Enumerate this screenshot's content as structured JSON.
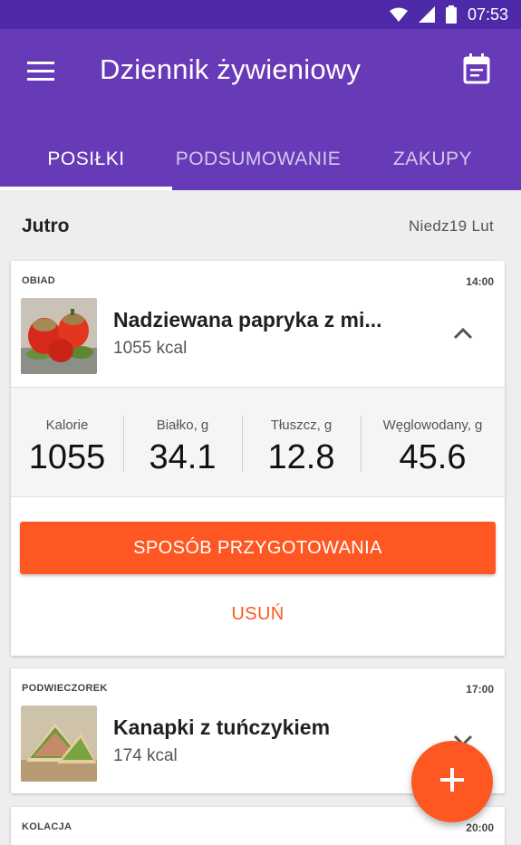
{
  "status_bar": {
    "time": "07:53"
  },
  "app_bar": {
    "title": "Dziennik żywieniowy"
  },
  "tabs": [
    {
      "label": "POSIŁKI",
      "active": true
    },
    {
      "label": "PODSUMOWANIE",
      "active": false
    },
    {
      "label": "ZAKUPY",
      "active": false
    }
  ],
  "day": {
    "label": "Jutro",
    "date": "Niedz19 Lut"
  },
  "meals": [
    {
      "type": "OBIAD",
      "time": "14:00",
      "name": "Nadziewana papryka z mi...",
      "kcal": "1055 kcal",
      "expanded": true,
      "nutrition": [
        {
          "label": "Kalorie",
          "value": "1055"
        },
        {
          "label": "Białko, g",
          "value": "34.1"
        },
        {
          "label": "Tłuszcz, g",
          "value": "12.8"
        },
        {
          "label": "Węglowodany, g",
          "value": "45.6"
        }
      ],
      "prep_button": "SPOSÓB PRZYGOTOWANIA",
      "delete_button": "USUŃ"
    },
    {
      "type": "PODWIECZOREK",
      "time": "17:00",
      "name": "Kanapki z tuńczykiem",
      "kcal": "174 kcal",
      "expanded": false
    },
    {
      "type": "KOLACJA",
      "time": "20:00"
    }
  ],
  "fab": {
    "icon": "plus-icon",
    "color": "#ff5722"
  },
  "colors": {
    "primary": "#673ab7",
    "status_bar": "#4f2aa8",
    "accent": "#ff5722"
  }
}
